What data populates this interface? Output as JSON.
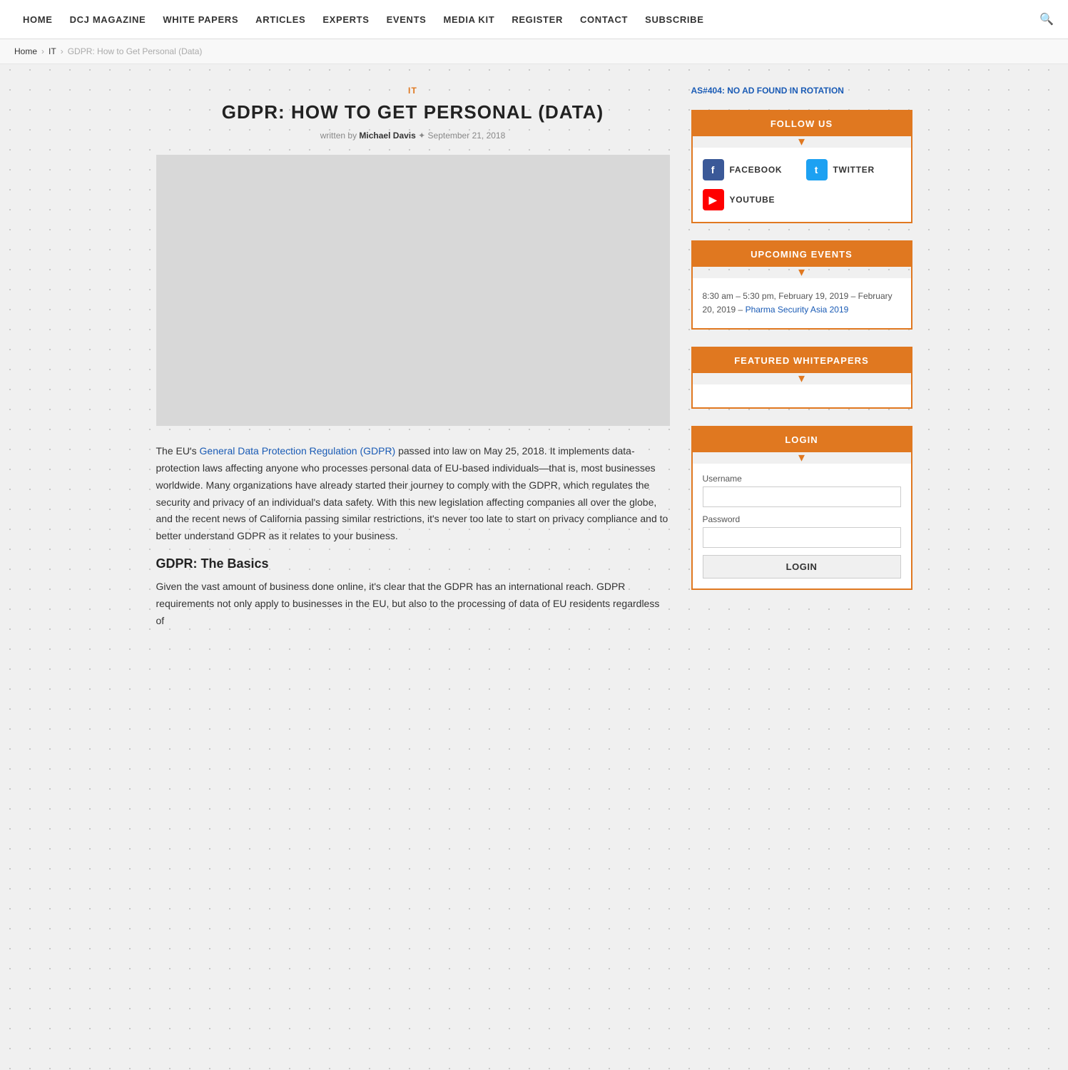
{
  "nav": {
    "items": [
      {
        "label": "HOME",
        "href": "#"
      },
      {
        "label": "DCJ MAGAZINE",
        "href": "#"
      },
      {
        "label": "WHITE PAPERS",
        "href": "#"
      },
      {
        "label": "ARTICLES",
        "href": "#"
      },
      {
        "label": "EXPERTS",
        "href": "#"
      },
      {
        "label": "EVENTS",
        "href": "#"
      },
      {
        "label": "MEDIA KIT",
        "href": "#"
      },
      {
        "label": "REGISTER",
        "href": "#"
      },
      {
        "label": "CONTACT",
        "href": "#"
      },
      {
        "label": "SUBSCRIBE",
        "href": "#"
      }
    ]
  },
  "breadcrumb": {
    "home": "Home",
    "section": "IT",
    "current": "GDPR: How to Get Personal (Data)"
  },
  "article": {
    "category": "IT",
    "title": "GDPR: HOW TO GET PERSONAL (DATA)",
    "meta_written_by": "written by",
    "author": "Michael Davis",
    "date": "September 21, 2018",
    "gdpr_link_text": "General Data Protection Regulation (GDPR)",
    "body_p1": "The EU's General Data Protection Regulation (GDPR) passed into law on May 25, 2018. It implements data-protection laws affecting anyone who processes personal data of EU-based individuals—that is, most businesses worldwide. Many organizations have already started their journey to comply with the GDPR, which regulates the security and privacy of an individual's data safety. With this new legislation affecting companies all over the globe, and the recent news of California passing similar restrictions, it's never too late to start on privacy compliance and to better understand GDPR as it relates to your business.",
    "subheading1": "GDPR: The Basics",
    "body_p2": "Given the vast amount of business done online, it's clear that the GDPR has an international reach. GDPR requirements not only apply to businesses in the EU, but also to the processing of data of EU residents regardless of"
  },
  "sidebar": {
    "ad_notice": "AS#404: NO AD FOUND IN ROTATION",
    "follow_us": {
      "header": "FOLLOW US",
      "facebook_label": "FACEBOOK",
      "twitter_label": "TWITTER",
      "youtube_label": "YOUTUBE"
    },
    "upcoming_events": {
      "header": "UPCOMING EVENTS",
      "event1_time": "8:30 am – 5:30 pm, February 19, 2019 – February 20, 2019 –",
      "event1_link": "Pharma Security Asia 2019"
    },
    "featured_whitepapers": {
      "header": "FEATURED WHITEPAPERS"
    },
    "login": {
      "header": "LOGIN",
      "username_label": "Username",
      "password_label": "Password",
      "button_label": "LOGIN"
    }
  }
}
